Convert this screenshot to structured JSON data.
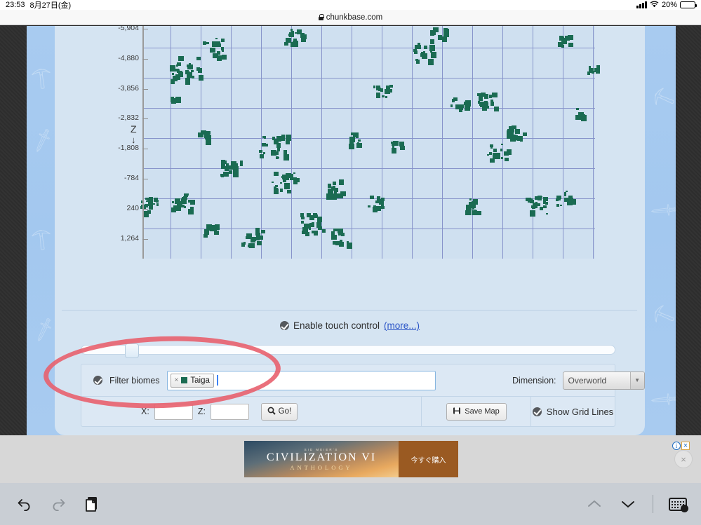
{
  "status_bar": {
    "time": "23:53",
    "date": "8月27日(金)",
    "battery_percent": "20%",
    "signal_icon": "signal-bars-icon",
    "wifi_icon": "wifi-icon",
    "battery_icon": "battery-icon"
  },
  "browser": {
    "url": "chunkbase.com",
    "lock_icon": "lock-icon"
  },
  "map": {
    "axis_title": "Z",
    "axis_arrow": "↓",
    "z_tick_labels": [
      "-5,904",
      "-4,880",
      "-3,856",
      "-2,832",
      "-1,808",
      "-784",
      "240",
      "1,264"
    ],
    "biome_color": "#1a6b52",
    "background_color": "#cfe0f0",
    "grid_color": "#7b86c4"
  },
  "controls": {
    "touch_control_label": "Enable touch control",
    "touch_control_checked": true,
    "more_link": "(more...)",
    "zoom_slider_name": "zoom-slider",
    "filter_biomes_label": "Filter biomes",
    "filter_biomes_checked": true,
    "biome_tags": [
      {
        "label": "Taiga",
        "color": "#1a6b52",
        "remove_icon": "×"
      }
    ],
    "dimension_label": "Dimension:",
    "dimension_value": "Overworld",
    "dimension_arrow_icon": "chevron-down-icon",
    "x_label": "X:",
    "x_value": "",
    "z_label": "Z:",
    "z_value": "",
    "go_label": "Go!",
    "go_icon": "search-icon",
    "save_map_label": "Save Map",
    "save_map_icon": "save-icon",
    "show_grid_lines_label": "Show Grid Lines",
    "show_grid_lines_checked": true
  },
  "ad": {
    "kicker": "SID MEIER'S",
    "title": "CIVILIZATION VI",
    "subtitle": "ANTHOLOGY",
    "cta": "今すぐ購入",
    "adchoices_icon": "info-icon",
    "close_icon": "×",
    "dismiss_icon": "×"
  },
  "toolbar": {
    "undo_icon": "undo-arrow-icon",
    "redo_icon": "redo-arrow-icon",
    "paste_icon": "paste-clipboard-icon",
    "prev_icon": "chevron-up-icon",
    "next_icon": "chevron-down-icon",
    "keyboard_icon": "keyboard-dismiss-icon"
  }
}
